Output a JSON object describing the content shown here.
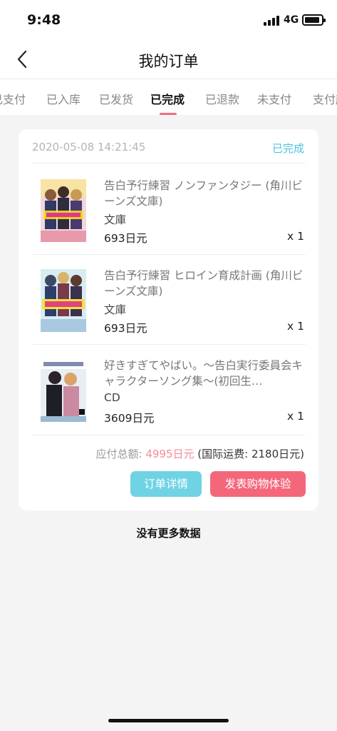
{
  "status_bar": {
    "time": "9:48",
    "network": "4G"
  },
  "header": {
    "title": "我的订单",
    "back_icon": "chevron-left-icon"
  },
  "tabs": [
    {
      "label": "已支付",
      "active": false
    },
    {
      "label": "已入库",
      "active": false
    },
    {
      "label": "已发货",
      "active": false
    },
    {
      "label": "已完成",
      "active": true
    },
    {
      "label": "已退款",
      "active": false
    },
    {
      "label": "未支付",
      "active": false
    },
    {
      "label": "支付超",
      "active": false
    }
  ],
  "order": {
    "datetime": "2020-05-08 14:21:45",
    "status": "已完成",
    "items": [
      {
        "name": "告白予行練習 ノンファンタジー (角川ビーンズ文庫)",
        "format": "文庫",
        "price": "693日元",
        "qty": "x 1"
      },
      {
        "name": "告白予行練習 ヒロイン育成計画 (角川ビーンズ文庫)",
        "format": "文庫",
        "price": "693日元",
        "qty": "x 1"
      },
      {
        "name": "好きすぎてやばい。～告白実行委員会キャラクターソング集～(初回生…",
        "format": "CD",
        "price": "3609日元",
        "qty": "x 1"
      }
    ],
    "total_label": "应付总额:",
    "total_amount": "4995日元",
    "shipping_note": "(国际运费: 2180日元)",
    "detail_button": "订单详情",
    "review_button": "发表购物体验"
  },
  "footer": {
    "no_more": "没有更多数据"
  },
  "colors": {
    "accent_pink": "#f4677a",
    "accent_cyan": "#6fd3e4",
    "status_blue": "#4cc3df",
    "amount_pink": "#f48a98"
  }
}
